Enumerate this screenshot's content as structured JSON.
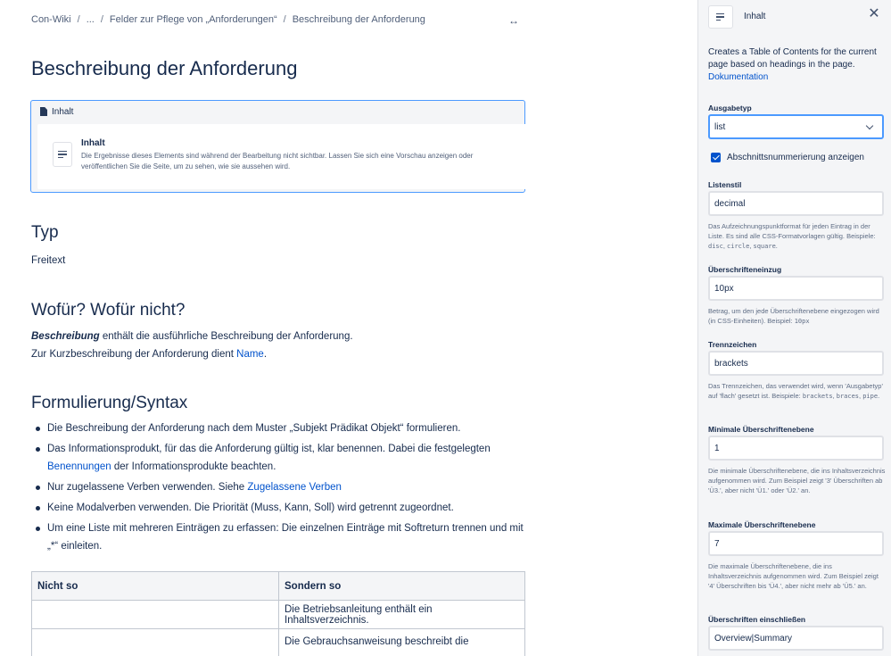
{
  "breadcrumb": {
    "items": [
      "Con-Wiki",
      "...",
      "Felder zur Pflege von „Anforderungen“",
      "Beschreibung der Anforderung"
    ],
    "separator": "/"
  },
  "page": {
    "title": "Beschreibung der Anforderung"
  },
  "macro": {
    "header_label": "Inhalt",
    "title": "Inhalt",
    "description": "Die Ergebnisse dieses Elements sind während der Bearbeitung nicht sichtbar. Lassen Sie sich eine Vorschau anzeigen oder veröffentlichen Sie die Seite, um zu sehen, wie sie aussehen wird."
  },
  "sections": {
    "typ": {
      "heading": "Typ",
      "text": "Freitext"
    },
    "wofuer": {
      "heading": "Wofür? Wofür nicht?",
      "line1_bold": "Beschreibung",
      "line1_rest": " enthält die ausführliche Beschreibung der Anforderung.",
      "line2_prefix": "Zur Kurzbeschreibung der Anforderung dient ",
      "line2_link": "Name",
      "line2_suffix": "."
    },
    "formulierung": {
      "heading": "Formulierung/Syntax",
      "bullets": [
        {
          "text": "Die Beschreibung der Anforderung nach dem Muster „Subjekt Prädikat Objekt“ formulieren."
        },
        {
          "before": "Das Informationsprodukt, für das die Anforderung gültig ist, klar benennen. Dabei die festgelegten ",
          "link": "Benennungen",
          "after": " der Informationsprodukte beachten."
        },
        {
          "before": "Nur zugelassene Verben verwenden. Siehe ",
          "link": "Zugelassene Verben",
          "after": ""
        },
        {
          "text": "Keine Modalverben verwenden. Die Priorität (Muss, Kann, Soll) wird getrennt zugeordnet."
        },
        {
          "text": "Um eine Liste mit mehreren Einträgen zu erfassen: Die einzelnen Einträge mit Softreturn trennen und mit „*“ einleiten."
        }
      ]
    }
  },
  "table": {
    "headers": [
      "Nicht so",
      "Sondern so"
    ],
    "rows": [
      [
        "",
        "Die Betriebsanleitung enthält ein Inhaltsverzeichnis."
      ],
      [
        "",
        "Die Gebrauchsanweisung beschreibt die"
      ]
    ]
  },
  "panel": {
    "title": "Inhalt",
    "intro": "Creates a Table of Contents for the current page based on headings in the page.",
    "doc_link": "Dokumentation",
    "ausgabetyp": {
      "label": "Ausgabetyp",
      "value": "list"
    },
    "checkbox": {
      "label": "Abschnittsnummerierung anzeigen",
      "checked": true
    },
    "listenstil": {
      "label": "Listenstil",
      "value": "decimal",
      "help_text": "Das Aufzeichnungspunktformat für jeden Eintrag in der Liste. Es sind alle CSS-Formatvorlagen gültig. Beispiele: ",
      "help_codes": [
        "disc",
        "circle",
        "square"
      ]
    },
    "einzug": {
      "label": "Überschrifteneinzug",
      "value": "10px",
      "help_text": "Betrag, um den jede Überschriftenebene eingezogen wird (in CSS-Einheiten). Beispiel: ",
      "help_code": "10px"
    },
    "trennzeichen": {
      "label": "Trennzeichen",
      "value": "brackets",
      "help_text": "Das Trennzeichen, das verwendet wird, wenn 'Ausgabetyp' auf 'flach' gesetzt ist. Beispiele: ",
      "help_codes": [
        "brackets",
        "braces",
        "pipe"
      ]
    },
    "min_ebene": {
      "label": "Minimale Überschriftenebene",
      "value": "1",
      "help": "Die minimale Überschriftenebene, die ins Inhaltsverzeichnis aufgenommen wird. Zum Beispiel zeigt '3' Überschriften ab 'Ü3.', aber nicht 'Ü1.' oder 'Ü2.' an."
    },
    "max_ebene": {
      "label": "Maximale Überschriftenebene",
      "value": "7",
      "help": "Die maximale Überschriftenebene, die ins Inhaltsverzeichnis aufgenommen wird. Zum Beispiel zeigt '4' Überschriften bis 'Ü4.', aber nicht mehr ab 'Ü5.' an."
    },
    "einschliessen": {
      "label": "Überschriften einschließen",
      "value": "Overview|Summary"
    }
  }
}
